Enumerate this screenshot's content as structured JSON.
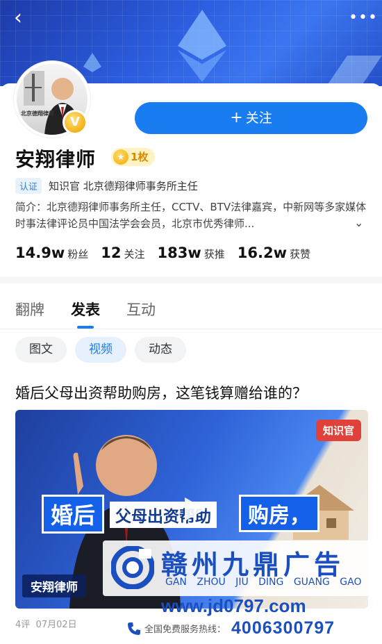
{
  "header": {
    "back_label": "‹",
    "more_label": "•••"
  },
  "profile": {
    "avatar_firm_text": "北京德翔律师",
    "verified_badge": "V",
    "name": "安翔律师",
    "medal_count": "1枚",
    "cert_tag": "认证",
    "cert_text": "知识官 北京德翔律师事务所主任",
    "intro_label": "简介：",
    "intro_text": "北京德翔律师事务所主任，CCTV、BTV法律嘉宾，中新网等多家媒体时事法律评论员中国法学会会员，北京市优秀律师...",
    "follow_label": "关注"
  },
  "stats": [
    {
      "num": "14.9w",
      "label": "粉丝"
    },
    {
      "num": "12",
      "label": "关注"
    },
    {
      "num": "183w",
      "label": "获推"
    },
    {
      "num": "16.2w",
      "label": "获赞"
    }
  ],
  "tabs": [
    {
      "label": "翻牌",
      "active": false
    },
    {
      "label": "发表",
      "active": true
    },
    {
      "label": "互动",
      "active": false
    }
  ],
  "chips": [
    {
      "label": "图文",
      "active": false
    },
    {
      "label": "视频",
      "active": true
    },
    {
      "label": "动态",
      "active": false
    }
  ],
  "post": {
    "title": "婚后父母出资帮助购房，这笔钱算赠给谁的？",
    "video": {
      "logo": "知识官",
      "headline_1": "婚后",
      "headline_2": "父母出资帮助",
      "headline_3": "购房，",
      "presenter": "安翔律师"
    },
    "comments": "4评",
    "date": "07月02日"
  },
  "watermark": {
    "name": "赣州九鼎广告",
    "pinyin": "GAN ZHOU JIU DING GUANG GAO",
    "url": "www.jd0797.com",
    "hotline_label": "全国免费服务热线：",
    "hotline_number": "4006300797"
  },
  "colors": {
    "accent": "#1a7cf1",
    "banner": "#2c5ee0",
    "watermark": "#1b4fc0"
  }
}
